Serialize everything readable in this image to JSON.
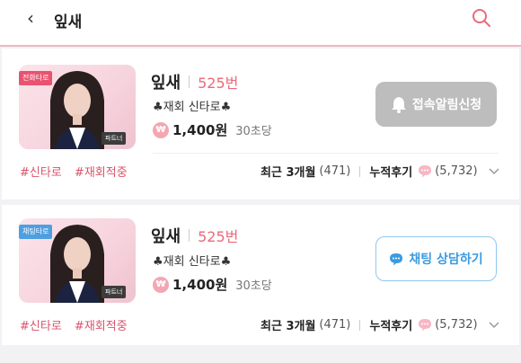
{
  "header": {
    "back_icon": "chevron-left-icon",
    "title": "잎새",
    "search_icon": "search-icon",
    "accent_color": "#e96a7a"
  },
  "cards": [
    {
      "tag": "전화타로",
      "partner_badge": "파트너",
      "name": "잎새",
      "number": "525번",
      "description": "♣재회 신타로♣",
      "price": "1,400원",
      "per": "30초당",
      "action_label": "접속알림신청",
      "action_icon": "bell-icon",
      "hashtags": [
        "#신타로",
        "#재회적중"
      ],
      "recent_label": "최근 3개월",
      "recent_count": "(471)",
      "total_label": "누적후기",
      "total_count": "(5,732)"
    },
    {
      "tag": "채팅타로",
      "partner_badge": "파트너",
      "name": "잎새",
      "number": "525번",
      "description": "♣재회 신타로♣",
      "price": "1,400원",
      "per": "30초당",
      "action_label": "채팅 상담하기",
      "action_icon": "chat-bubble-icon",
      "hashtags": [
        "#신타로",
        "#재회적중"
      ],
      "recent_label": "최근 3개월",
      "recent_count": "(471)",
      "total_label": "누적후기",
      "total_count": "(5,732)"
    }
  ]
}
